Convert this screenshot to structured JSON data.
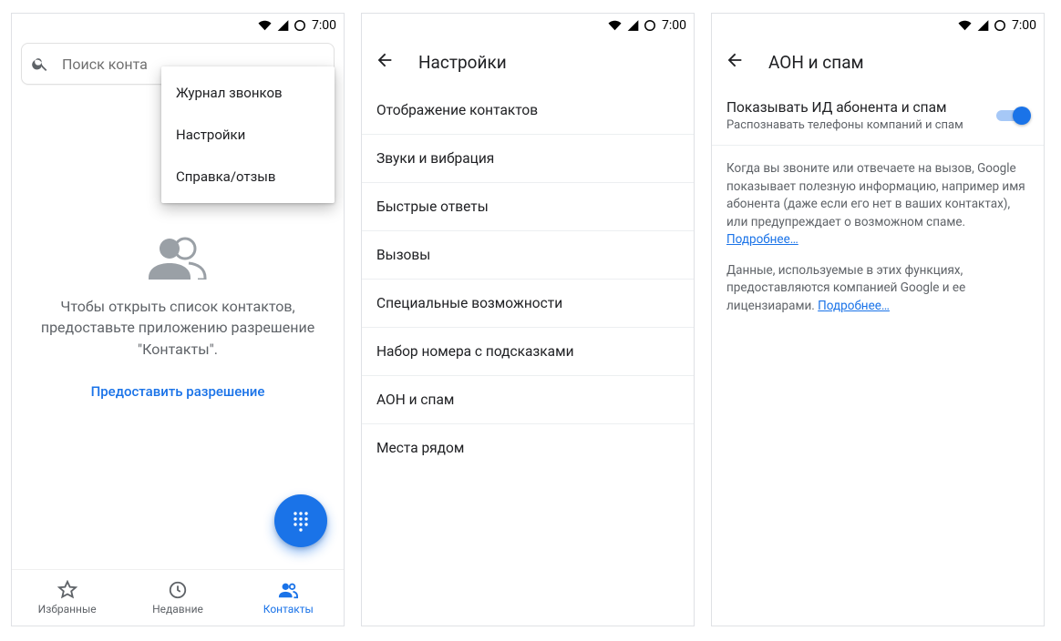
{
  "status": {
    "time": "7:00"
  },
  "screen1": {
    "search_placeholder": "Поиск конта",
    "menu": {
      "call_log": "Журнал звонков",
      "settings": "Настройки",
      "help": "Справка/отзыв"
    },
    "empty_text": "Чтобы открыть список контактов, предоставьте приложению разрешение \"Контакты\".",
    "grant": "Предоставить разрешение",
    "nav": {
      "favorites": "Избранные",
      "recents": "Недавние",
      "contacts": "Контакты"
    }
  },
  "screen2": {
    "title": "Настройки",
    "items": [
      "Отображение контактов",
      "Звуки и вибрация",
      "Быстрые ответы",
      "Вызовы",
      "Специальные возможности",
      "Набор номера с подсказками",
      "АОН и спам",
      "Места рядом"
    ]
  },
  "screen3": {
    "title": "АОН и спам",
    "toggle_title": "Показывать ИД абонента и спам",
    "toggle_sub": "Распознавать телефоны компаний и спам",
    "para1_a": "Когда вы звоните или отвечаете на вызов, Google показывает полезную информацию, например имя абонента (даже если его нет в ваших контактах), или предупреждает о возможном спаме. ",
    "para2_a": "Данные, используемые в этих функциях, предоставляются компанией Google и ее лицензиарами. ",
    "learn_more": "Подробнее…"
  }
}
